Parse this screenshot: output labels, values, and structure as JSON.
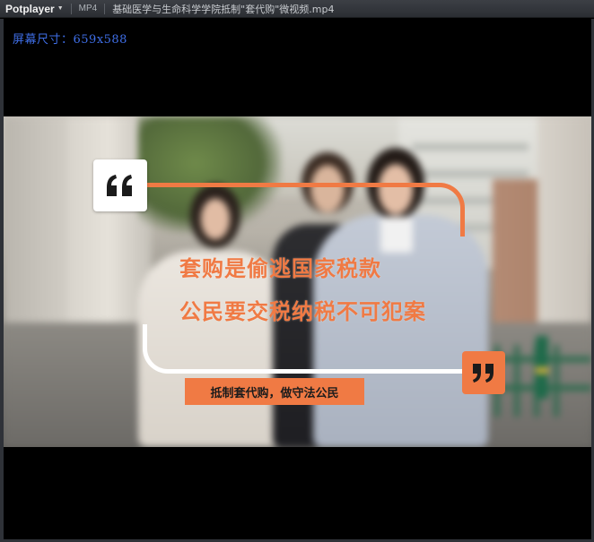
{
  "titlebar": {
    "app_name": "Potplayer",
    "format": "MP4",
    "file_name": "基础医学与生命科学学院抵制\"套代购\"微视频.mp4"
  },
  "osd": {
    "screen_size_text": "屏幕尺寸：659x588"
  },
  "video": {
    "slogan_line1": "套购是偷逃国家税款",
    "slogan_line2": "公民要交税纳税不可犯案",
    "tagline": "抵制套代购，做守法公民",
    "colors": {
      "accent": "#f07a44",
      "quote_box": "#ffffff",
      "osd_text": "#3f6fe8"
    },
    "icons": {
      "open_quote": "open-quote-icon",
      "close_quote": "close-quote-icon"
    }
  }
}
